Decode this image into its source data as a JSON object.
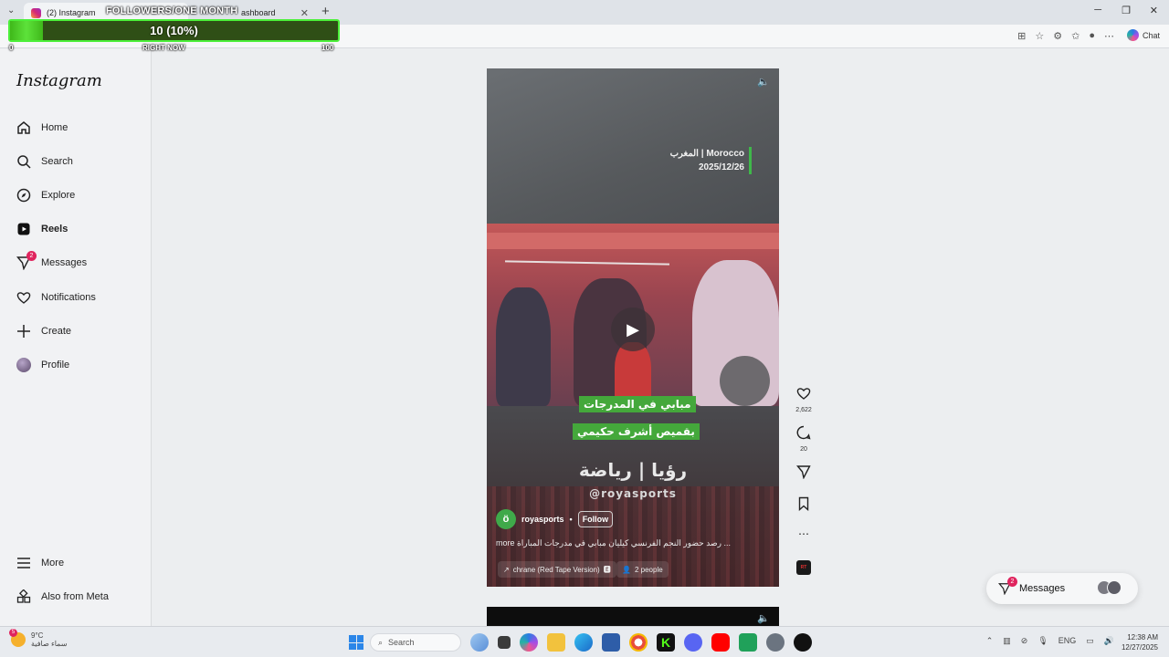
{
  "browser": {
    "tabs": [
      {
        "label": "(2) Instagram"
      },
      {
        "label": "ashboard"
      }
    ],
    "chat_label": "Chat"
  },
  "overlay": {
    "title": "FOLLOWERS/ONE MONTH",
    "value_text": "10 (10%)",
    "progress_fraction": 0.1,
    "min_label": "0",
    "mid_label": "RIGHT NOW",
    "max_label": "100"
  },
  "instagram": {
    "logo": "Instagram",
    "nav": [
      {
        "label": "Home",
        "icon": "home-icon"
      },
      {
        "label": "Search",
        "icon": "search-icon"
      },
      {
        "label": "Explore",
        "icon": "compass-icon"
      },
      {
        "label": "Reels",
        "icon": "reels-icon"
      },
      {
        "label": "Messages",
        "icon": "send-icon",
        "badge": "2"
      },
      {
        "label": "Notifications",
        "icon": "heart-icon"
      },
      {
        "label": "Create",
        "icon": "plus-icon"
      },
      {
        "label": "Profile",
        "icon": "avatar"
      }
    ],
    "bottom_nav": [
      {
        "label": "More",
        "icon": "menu-icon"
      },
      {
        "label": "Also from Meta",
        "icon": "meta-apps-icon"
      }
    ]
  },
  "reel": {
    "place": "المغرب | Morocco",
    "date": "2025/12/26",
    "caption_line1": "مبابي في المدرجات",
    "caption_line2": "بقميص أشرف حكيمي",
    "brand_text": "رؤيا | رياضة",
    "brand_handle": "@royasports",
    "username": "royasports",
    "separator": "•",
    "follow_label": "Follow",
    "description": "رصد حضور النجم الفرنسي كيليان مبابي في مدرجات المباراة ...",
    "more_label": "more",
    "audio_chip": "chrane (Red Tape Version)",
    "people_chip": "2 people",
    "likes": "2,622",
    "comments": "20",
    "audio_thumb_text": "RT"
  },
  "messages_pill": {
    "label": "Messages",
    "badge": "2"
  },
  "taskbar": {
    "weather_temp": "9°C",
    "weather_desc": "سماء صافية",
    "weather_badge": "5",
    "search_placeholder": "Search",
    "lang": "ENG",
    "time": "12:38 AM",
    "date": "12/27/2025"
  },
  "colors": {
    "overlay_green": "#4cf03a",
    "caption_green": "#44a83b",
    "badge_red": "#e0245e"
  }
}
